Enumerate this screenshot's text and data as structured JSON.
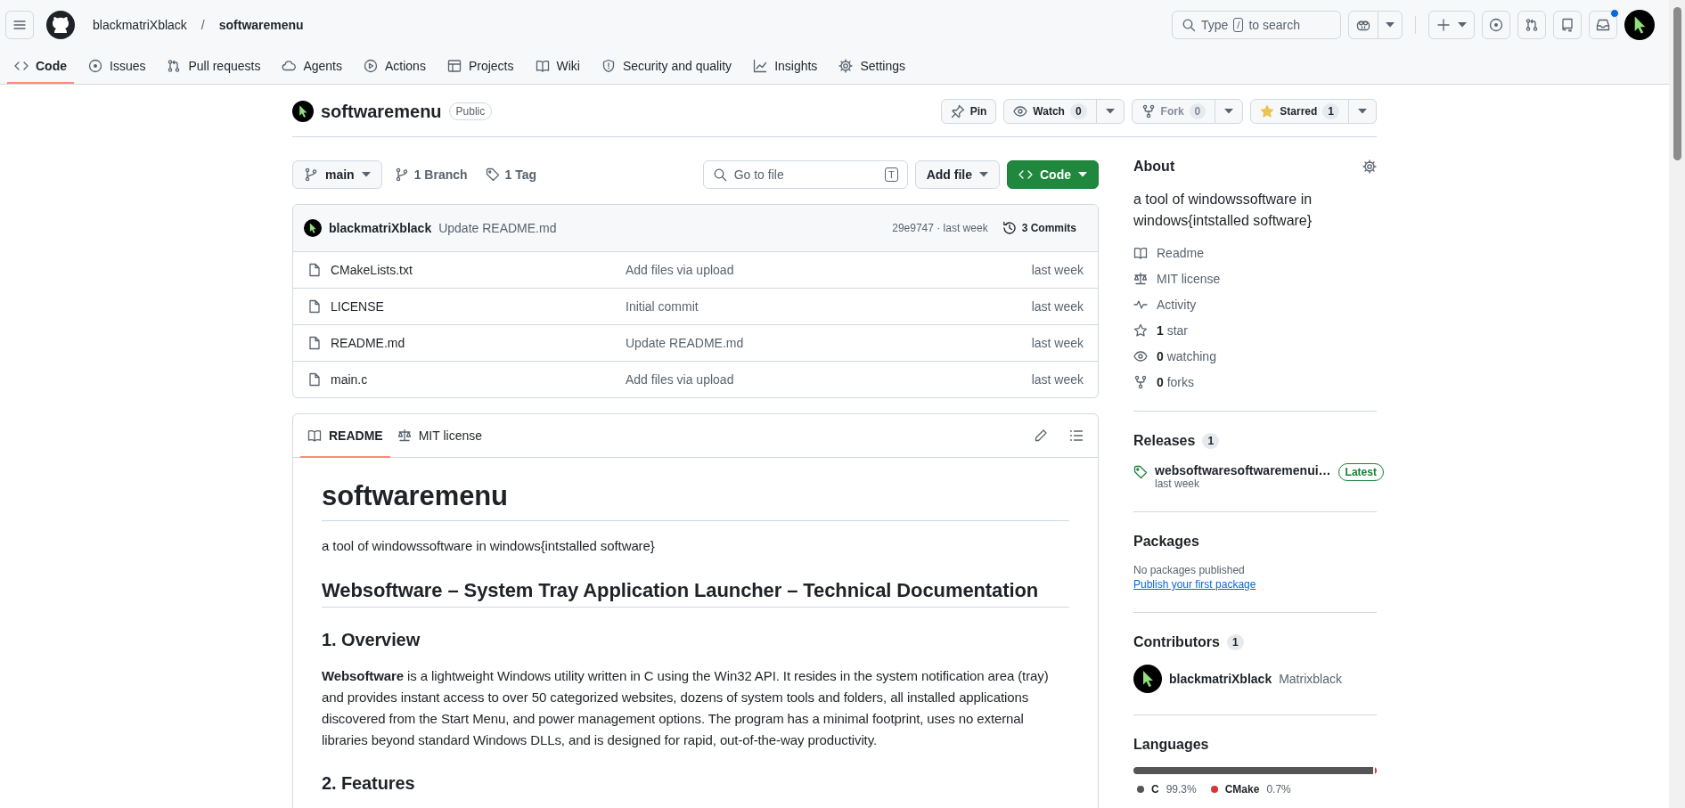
{
  "header": {
    "owner": "blackmatriXblack",
    "separator": "/",
    "repo": "softwaremenu",
    "search": {
      "placeholder": "Type",
      "key": "/",
      "placeholder_end": "to search"
    },
    "notifications_unread": true
  },
  "nav_tabs": [
    {
      "label": "Code",
      "selected": true
    },
    {
      "label": "Issues",
      "selected": false
    },
    {
      "label": "Pull requests",
      "selected": false
    },
    {
      "label": "Agents",
      "selected": false
    },
    {
      "label": "Actions",
      "selected": false
    },
    {
      "label": "Projects",
      "selected": false
    },
    {
      "label": "Wiki",
      "selected": false
    },
    {
      "label": "Security and quality",
      "selected": false
    },
    {
      "label": "Insights",
      "selected": false
    },
    {
      "label": "Settings",
      "selected": false
    }
  ],
  "repo": {
    "name": "softwaremenu",
    "visibility": "Public",
    "actions": [
      {
        "label": "Pin",
        "disabled": false,
        "active": false,
        "has_menu": false
      },
      {
        "label": "Watch",
        "count": "0",
        "disabled": false,
        "active": false,
        "has_menu": true
      },
      {
        "label": "Fork",
        "count": "0",
        "disabled": true,
        "active": false,
        "has_menu": true
      },
      {
        "label": "Starred",
        "count": "1",
        "disabled": false,
        "active": true,
        "has_menu": true
      }
    ]
  },
  "branch_bar": {
    "branch": "main",
    "branches": "1 Branch",
    "tags": "1 Tag",
    "file_search": {
      "placeholder": "Go to file",
      "shortcut": "T"
    },
    "add_file": "Add file",
    "code": "Code"
  },
  "latest_commit": {
    "author": "blackmatriXblack",
    "message": "Update README.md",
    "hash_time": "29e9747 · last week",
    "commits": "3 Commits"
  },
  "files": [
    {
      "name": "CMakeLists.txt",
      "message": "Add files via upload",
      "time": "last week"
    },
    {
      "name": "LICENSE",
      "message": "Initial commit",
      "time": "last week"
    },
    {
      "name": "README.md",
      "message": "Update README.md",
      "time": "last week"
    },
    {
      "name": "main.c",
      "message": "Add files via upload",
      "time": "last week"
    }
  ],
  "readme": {
    "tabs": [
      {
        "label": "README",
        "selected": true
      },
      {
        "label": "MIT license",
        "selected": false
      }
    ],
    "title": "softwaremenu",
    "description": "a tool of windowssoftware in windows{intstalled software}",
    "heading": "Websoftware – System Tray Application Launcher – Technical Documentation",
    "section_1": "1. Overview",
    "paragraph": "**Websoftware** is a lightweight Windows utility written in C using the Win32 API. It resides in the system notification area (tray) and provides instant access to over 50 categorized websites, dozens of system tools and folders, all installed applications discovered from the Start Menu, and power management options. The program has a minimal footprint, uses no external libraries beyond standard Windows DLLs, and is designed for rapid, out-of-the-way productivity.",
    "section_2": "2. Features"
  },
  "about": {
    "title": "About",
    "description": "a tool of windowssoftware in windows{intstalled software}",
    "links": [
      {
        "text": "Readme"
      },
      {
        "text": "MIT license"
      },
      {
        "text": "Activity"
      },
      {
        "text": "**1** star"
      },
      {
        "text": "**0** watching"
      },
      {
        "text": "**0** forks"
      }
    ]
  },
  "releases": {
    "title": "Releases",
    "count": "1",
    "items": [
      {
        "name": "websoftwaresoftwaremenui…",
        "badge": "Latest",
        "time": "last week"
      }
    ]
  },
  "packages": {
    "title": "Packages",
    "empty": "No packages published",
    "link": "Publish your first package"
  },
  "contributors": {
    "title": "Contributors",
    "count": "1",
    "items": [
      {
        "login": "blackmatriXblack",
        "name": "Matrixblack"
      }
    ]
  },
  "languages": {
    "title": "Languages",
    "items": [
      {
        "name": "C",
        "percent": "99.3%",
        "color": "#555555",
        "level": 0.993
      },
      {
        "name": "CMake",
        "percent": "0.7%",
        "color": "#da3434",
        "level": 0.007
      }
    ]
  }
}
